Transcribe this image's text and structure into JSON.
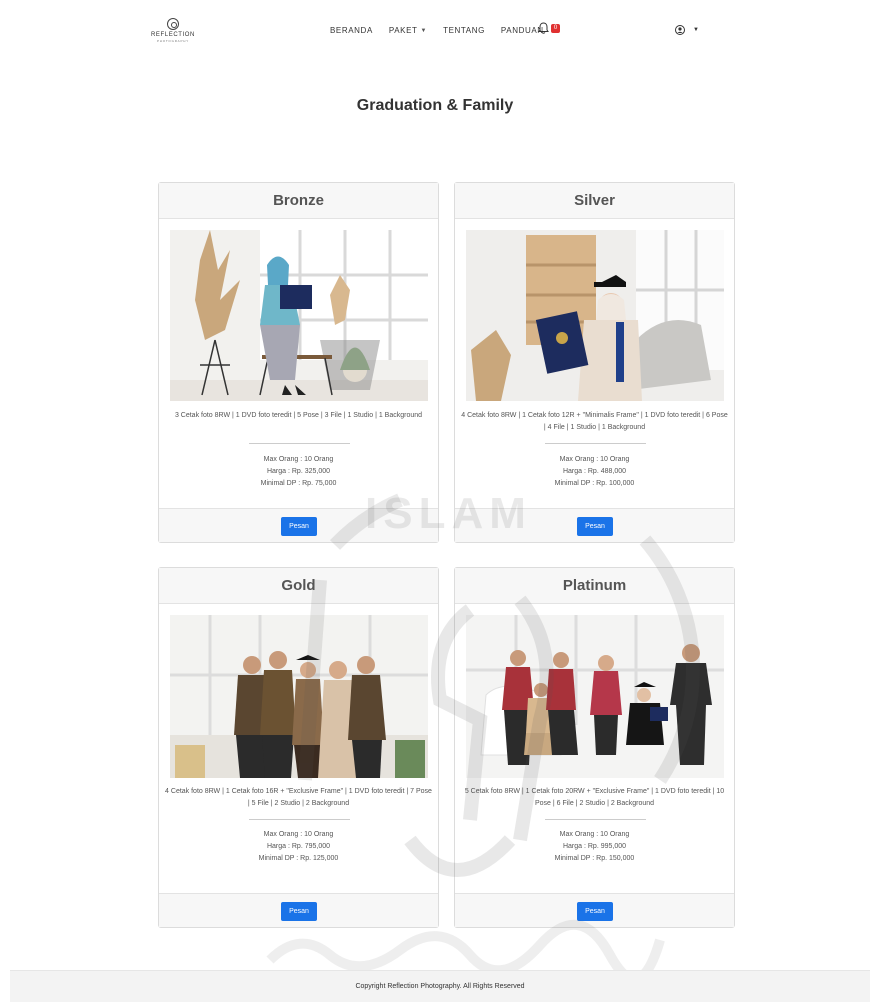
{
  "brand": {
    "name": "REFLECTION",
    "sub": "PHOTOGRAPHY"
  },
  "nav": {
    "items": [
      {
        "label": "BERANDA"
      },
      {
        "label": "PAKET"
      },
      {
        "label": "TENTANG"
      },
      {
        "label": "PANDUAN"
      }
    ],
    "notification_count": "0"
  },
  "page": {
    "title": "Graduation & Family"
  },
  "packages": [
    {
      "name": "Bronze",
      "description": "3 Cetak foto 8RW | 1 DVD foto teredit | 5 Pose | 3 File | 1 Studio | 1 Background",
      "max_people": "Max Orang : 10 Orang",
      "price": "Harga : Rp. 325,000",
      "min_dp": "Minimal DP : Rp. 75,000",
      "button": "Pesan"
    },
    {
      "name": "Silver",
      "description": "4 Cetak foto 8RW | 1 Cetak foto 12R + \"Minimalis Frame\" | 1 DVD foto teredit | 6 Pose | 4 File | 1 Studio | 1 Background",
      "max_people": "Max Orang : 10 Orang",
      "price": "Harga : Rp. 488,000",
      "min_dp": "Minimal DP : Rp. 100,000",
      "button": "Pesan"
    },
    {
      "name": "Gold",
      "description": "4 Cetak foto 8RW | 1 Cetak foto 16R + \"Exclusive Frame\" | 1 DVD foto teredit | 7 Pose | 5 File | 2 Studio | 2 Background",
      "max_people": "Max Orang : 10 Orang",
      "price": "Harga : Rp. 795,000",
      "min_dp": "Minimal DP : Rp. 125,000",
      "button": "Pesan"
    },
    {
      "name": "Platinum",
      "description": "5 Cetak foto 8RW | 1 Cetak foto 20RW + \"Exclusive Frame\" | 1 DVD foto teredit | 10 Pose | 6 File | 2 Studio | 2 Background",
      "max_people": "Max Orang : 10 Orang",
      "price": "Harga : Rp. 995,000",
      "min_dp": "Minimal DP : Rp. 150,000",
      "button": "Pesan"
    }
  ],
  "footer": {
    "text": "Copyright Reflection Photography. All Rights Reserved"
  },
  "watermark": {
    "text": "ISLAM"
  },
  "colors": {
    "primary_button": "#1a73e8",
    "badge": "#e03131"
  }
}
